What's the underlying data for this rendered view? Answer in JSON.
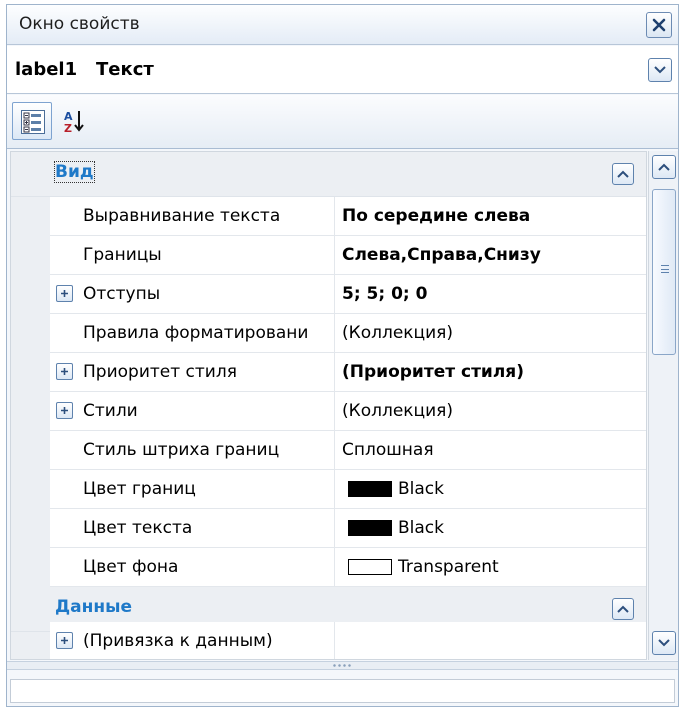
{
  "window": {
    "title": "Окно свойств"
  },
  "object": {
    "name": "label1",
    "type": "Текст"
  },
  "categories": [
    {
      "label": "Вид",
      "rows": [
        {
          "name": "Выравнивание текста",
          "value": "По середине слева",
          "bold": true,
          "expandable": false
        },
        {
          "name": "Границы",
          "value": "Слева,Справа,Снизу",
          "bold": true,
          "expandable": false
        },
        {
          "name": "Отступы",
          "value": "5; 5; 0; 0",
          "bold": true,
          "expandable": true
        },
        {
          "name": "Правила форматировани",
          "value": "(Коллекция)",
          "bold": false,
          "expandable": false
        },
        {
          "name": "Приоритет стиля",
          "value": "(Приоритет стиля)",
          "bold": true,
          "expandable": true
        },
        {
          "name": "Стили",
          "value": "(Коллекция)",
          "bold": false,
          "expandable": true
        },
        {
          "name": "Стиль штриха границ",
          "value": "Сплошная",
          "bold": false,
          "expandable": false
        },
        {
          "name": "Цвет границ",
          "value": "Black",
          "swatch": "#000000",
          "expandable": false
        },
        {
          "name": "Цвет текста",
          "value": "Black",
          "swatch": "#000000",
          "expandable": false
        },
        {
          "name": "Цвет фона",
          "value": "Transparent",
          "swatch": "transparent",
          "expandable": false
        }
      ]
    },
    {
      "label": "Данные",
      "rows": [
        {
          "name": "(Привязка к данным)",
          "value": "",
          "bold": false,
          "expandable": true
        }
      ]
    }
  ],
  "icons": {
    "close": "close-icon",
    "dropdown": "chevron-down-icon",
    "categorized": "categorized-view-icon",
    "alphabetical": "sort-az-icon",
    "collapse": "chevron-up-icon",
    "expand": "plus-icon",
    "scroll_up": "chevron-up-icon",
    "scroll_down": "chevron-down-icon"
  },
  "colors": {
    "category_label": "#1f79c8",
    "accent_border": "#5e82ad"
  }
}
